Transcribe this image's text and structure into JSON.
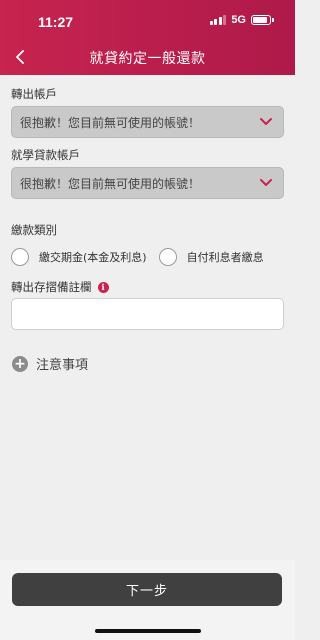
{
  "status_bar": {
    "time": "11:27",
    "network": "5G",
    "signal_bars_filled": 3,
    "battery_level": 0.85
  },
  "header": {
    "title": "就貸約定一般還款",
    "back_icon": "chevron-left-icon",
    "background_color": "#c7244f"
  },
  "form": {
    "from_account": {
      "label": "轉出帳戶",
      "value": "很抱歉！您目前無可使用的帳號！"
    },
    "loan_account": {
      "label": "就學貸款帳戶",
      "value": "很抱歉！您目前無可使用的帳號！"
    },
    "payment_type": {
      "label": "繳款類別",
      "options": [
        "繳交期金(本金及利息)",
        "自付利息者繳息"
      ]
    },
    "remark": {
      "label": "轉出存摺備註欄",
      "info_icon": "info-icon",
      "value": "",
      "placeholder": ""
    }
  },
  "notice": {
    "label": "注意事項",
    "icon": "plus-circle-icon"
  },
  "footer": {
    "next_label": "下一步"
  },
  "colors": {
    "accent": "#c7244f",
    "button": "#404040",
    "background": "#efefef"
  }
}
